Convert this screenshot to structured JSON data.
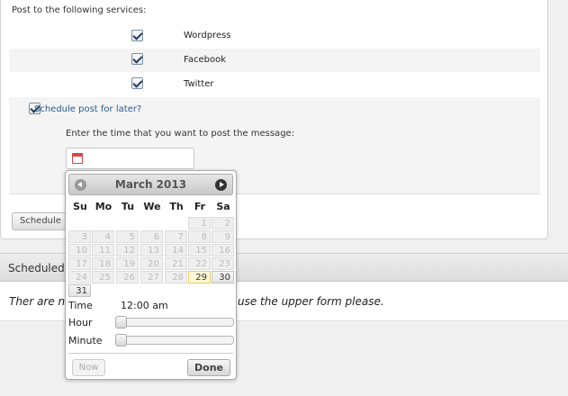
{
  "form": {
    "heading": "Post to the following services:",
    "services": [
      {
        "label": "Wordpress",
        "checked": true
      },
      {
        "label": "Facebook",
        "checked": true
      },
      {
        "label": "Twitter",
        "checked": true
      }
    ],
    "schedule_toggle_label": "Schedule post for later?",
    "schedule_toggle_checked": true,
    "time_prompt": "Enter the time that you want to post the message:",
    "time_value": "",
    "submit_label": "Schedule P"
  },
  "scheduled": {
    "heading": "Scheduled",
    "empty_left": "Ther are no",
    "empty_right": "use the upper form please."
  },
  "datepicker": {
    "month_title": "March 2013",
    "weekdays": [
      "Su",
      "Mo",
      "Tu",
      "We",
      "Th",
      "Fr",
      "Sa"
    ],
    "weeks": [
      [
        "",
        "",
        "",
        "",
        "",
        "1",
        "2"
      ],
      [
        "3",
        "4",
        "5",
        "6",
        "7",
        "8",
        "9"
      ],
      [
        "10",
        "11",
        "12",
        "13",
        "14",
        "15",
        "16"
      ],
      [
        "17",
        "18",
        "19",
        "20",
        "21",
        "22",
        "23"
      ],
      [
        "24",
        "25",
        "26",
        "27",
        "28",
        "29",
        "30"
      ],
      [
        "31",
        "",
        "",
        "",
        "",
        "",
        ""
      ]
    ],
    "selectable_days": [
      "29",
      "30",
      "31"
    ],
    "today": "29",
    "time_label": "Time",
    "time_value": "12:00 am",
    "hour_label": "Hour",
    "minute_label": "Minute",
    "hour_value": 0,
    "minute_value": 0,
    "now_label": "Now",
    "done_label": "Done"
  }
}
